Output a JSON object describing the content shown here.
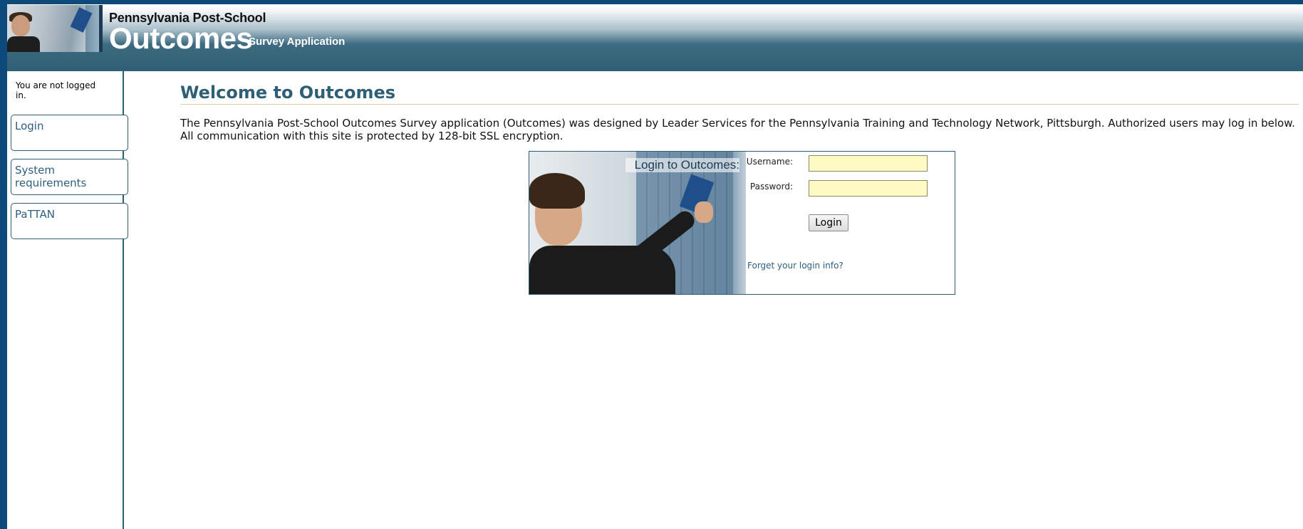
{
  "header": {
    "brand_top": "Pennsylvania Post-School",
    "brand_big": "Outcomes",
    "brand_sub": "Survey Application"
  },
  "sidebar": {
    "status": "You are not logged in.",
    "items": [
      {
        "label": "Login"
      },
      {
        "label": "System requirements"
      },
      {
        "label": "PaTTAN"
      }
    ]
  },
  "main": {
    "title": "Welcome to Outcomes",
    "intro": "The Pennsylvania Post-School Outcomes Survey application (Outcomes) was designed by Leader Services for the Pennsylvania Training and Technology Network, Pittsburgh. Authorized users may log in below. All communication with this site is protected by 128-bit SSL encryption."
  },
  "login": {
    "title": "Login to Outcomes:",
    "username_label": "Username:",
    "password_label": "Password:",
    "username_value": "",
    "password_value": "",
    "button_label": "Login",
    "forgot_label": "Forget your login info?"
  },
  "colors": {
    "page_border": "#0d4a7a",
    "header_teal": "#2f5f74",
    "input_bg": "#fffbc2",
    "link": "#2e6080"
  }
}
